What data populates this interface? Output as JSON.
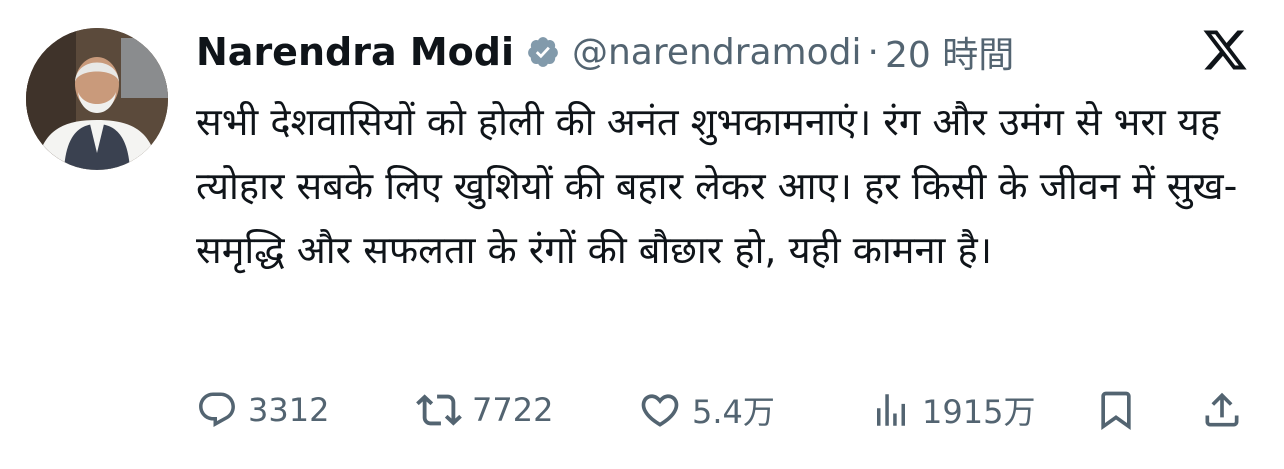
{
  "author": {
    "name": "Narendra Modi",
    "handle": "@narendramodi",
    "separator": "·",
    "time": "20 時間",
    "verified_icon": "verified-badge-icon"
  },
  "tweet": {
    "text": "सभी देशवासियों को होली की अनंत शुभकामनाएं। रंग और उमंग से भरा यह त्योहार सबके लिए खुशियों की बहार लेकर आए। हर किसी के जीवन में सुख-समृद्धि और सफलता के रंगों की बौछार हो, यही कामना है।"
  },
  "actions": {
    "replies": "3312",
    "reposts": "7722",
    "likes": "5.4万",
    "views": "1915万"
  },
  "icons": {
    "app_logo": "x-logo-icon",
    "reply": "reply-icon",
    "repost": "repost-icon",
    "like": "heart-icon",
    "views": "views-icon",
    "bookmark": "bookmark-icon",
    "share": "share-icon"
  },
  "colors": {
    "text": "#0f1419",
    "secondary": "#536471",
    "badge": "#829aab"
  }
}
